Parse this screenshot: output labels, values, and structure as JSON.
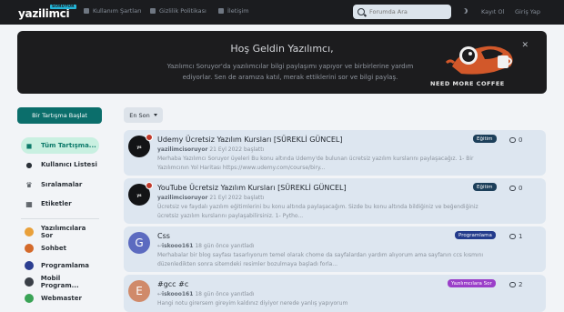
{
  "header": {
    "logo_text": "yazilimci",
    "logo_tag": "SORUYOR",
    "nav": [
      {
        "label": "Kullanım Şartları",
        "icon": "document-icon"
      },
      {
        "label": "Gizlilik Politikası",
        "icon": "lock-icon"
      },
      {
        "label": "İletişim",
        "icon": "mail-icon"
      }
    ],
    "search_placeholder": "Forumda Ara",
    "login_label": "Kayıt Ol",
    "register_label": "Giriş Yap"
  },
  "banner": {
    "title": "Hoş Geldin Yazılımcı,",
    "text": "Yazılımcı Soruyor'da yazılımcılar bilgi paylaşımı yapıyor ve birbirlerine yardım ediyorlar. Sen de aramıza katıl, merak ettiklerini sor ve bilgi paylaş.",
    "image_caption": "NEED MORE COFFEE"
  },
  "sidebar": {
    "new_discussion": "Bir Tartışma Başlat",
    "items": [
      {
        "label": "Tüm Tartışma...",
        "icon": "chat-icon",
        "active": true
      },
      {
        "label": "Kullanıcı Listesi",
        "icon": "user-icon"
      },
      {
        "label": "Sıralamalar",
        "icon": "trophy-icon"
      },
      {
        "label": "Etiketler",
        "icon": "grid-icon"
      }
    ],
    "categories": [
      {
        "label": "Yazılımcılara Sor",
        "icon": "question-icon",
        "color": "#e9a03a"
      },
      {
        "label": "Sohbet",
        "icon": "coffee-icon",
        "color": "#d46a2b"
      },
      {
        "label": "Programlama",
        "icon": "code-icon",
        "color": "#2c3e91"
      },
      {
        "label": "Mobil Program...",
        "icon": "mobile-icon",
        "color": "#3a3f47"
      },
      {
        "label": "Webmaster",
        "icon": "web-icon",
        "color": "#3aa356"
      }
    ]
  },
  "sort": {
    "label": "En Son"
  },
  "topics": [
    {
      "title": "Udemy Ücretsiz Yazılım Kursları [SÜREKLİ GÜNCEL]",
      "author": "yazilimcisoruyor",
      "meta": "21 Eyl 2022 başlattı",
      "excerpt": "Merhaba Yazılımcı Soruyor üyeleri Bu konu altında Udemy'de bulunan ücretsiz yazılım kurslarını paylaşacağız. 1- Bir Yazılımcının Yol Haritası https://www.udemy.com/course/biry...",
      "tag": "Eğitim",
      "tag_color": "#1c3f5a",
      "replies": "0",
      "avatar": "logo",
      "avatar_letter": "",
      "avatar_color": "#131416",
      "pinned": true
    },
    {
      "title": "YouTube Ücretsiz Yazılım Kursları [SÜREKLİ GÜNCEL]",
      "author": "yazilimcisoruyor",
      "meta": "21 Eyl 2022 başlattı",
      "excerpt": "Ücretsiz ve faydalı yazılım eğitimlerini bu konu altında paylaşacağım. Sizde bu konu altında bildiğiniz ve beğendiğiniz ücretsiz yazılım kurslarını paylaşabilirsiniz. 1- Pytho...",
      "tag": "Eğitim",
      "tag_color": "#1c3f5a",
      "replies": "0",
      "avatar": "logo",
      "avatar_letter": "",
      "avatar_color": "#131416",
      "pinned": true
    },
    {
      "title": "Css",
      "author": "iskooo161",
      "meta": "18 gün önce yanıtladı",
      "excerpt": "Merhabalar bir blog sayfası tasarlıyorum temel olarak chome da sayfalardan yardım alıyorum ama sayfanın ccs kısmını düzenledikten sonra sitemdeki resimler bozulmaya başladı forla...",
      "tag": "Programlama",
      "tag_color": "#233b8c",
      "replies": "1",
      "avatar": "letter",
      "avatar_letter": "G",
      "avatar_color": "#5c6bc0",
      "pinned": false
    },
    {
      "title": "#gcc #c",
      "author": "iskooo161",
      "meta": "18 gün önce yanıtladı",
      "excerpt": "Hangi notu girersem gireyim kaldınız diyiyor nerede yanlış yapıyorum",
      "tag": "Yazılımcılara Sor",
      "tag_color": "#9b3fc9",
      "replies": "2",
      "avatar": "letter",
      "avatar_letter": "E",
      "avatar_color": "#d08a6a",
      "pinned": false
    }
  ]
}
